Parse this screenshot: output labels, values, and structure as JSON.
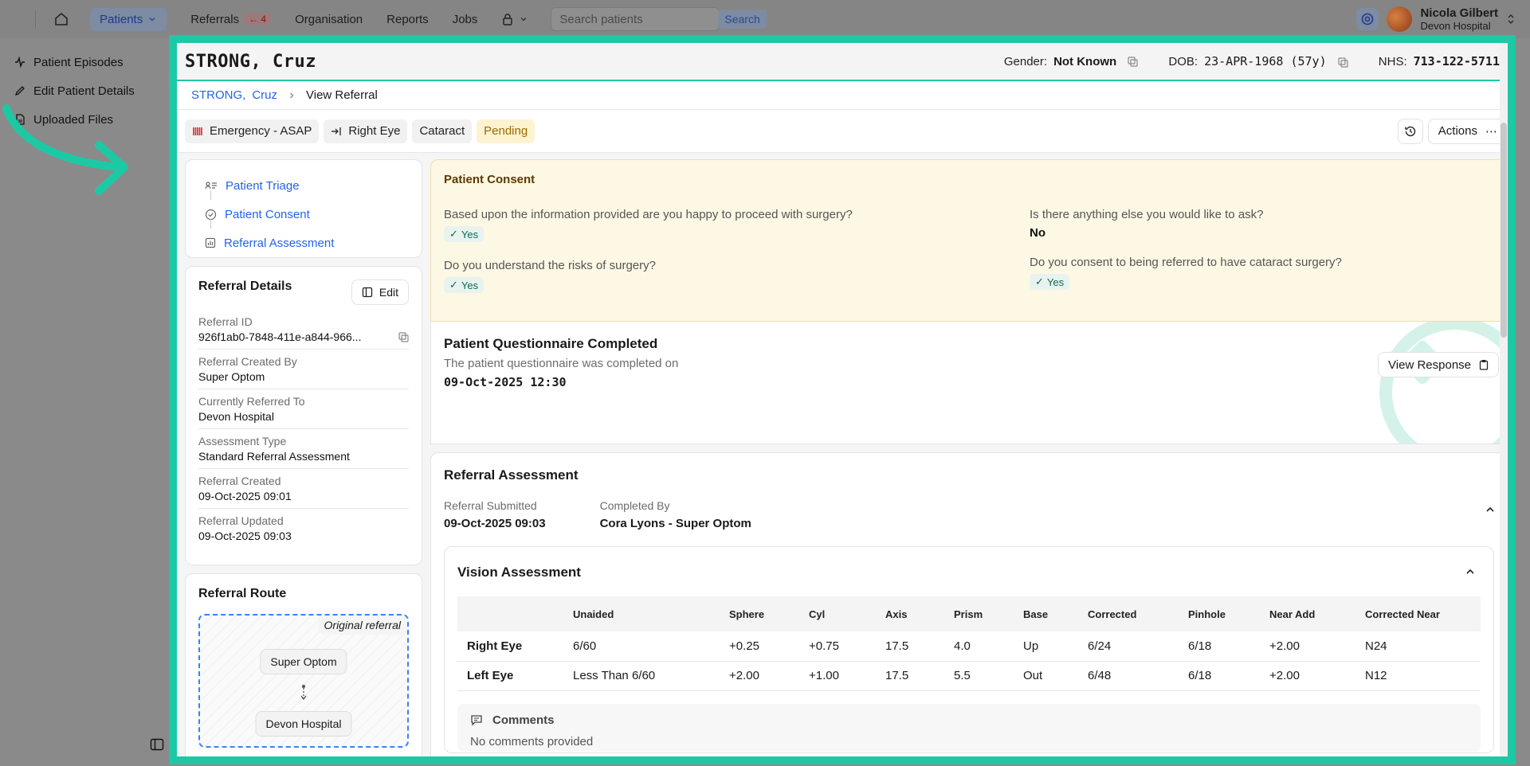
{
  "nav": {
    "items": [
      {
        "label": "Patients"
      },
      {
        "label": "Referrals",
        "badge": "4"
      },
      {
        "label": "Organisation"
      },
      {
        "label": "Reports"
      },
      {
        "label": "Jobs"
      }
    ],
    "search_placeholder": "Search patients",
    "search_button": "Search",
    "user_name": "Nicola Gilbert",
    "user_org": "Devon Hospital"
  },
  "sidebar": {
    "items": [
      {
        "label": "Patient Episodes",
        "icon": "activity-icon"
      },
      {
        "label": "Edit Patient Details",
        "icon": "pencil-icon"
      },
      {
        "label": "Uploaded Files",
        "icon": "file-icon"
      }
    ]
  },
  "patient": {
    "name": "STRONG, Cruz",
    "gender_label": "Gender:",
    "gender": "Not Known",
    "dob_label": "DOB:",
    "dob": "23-APR-1968 (57y)",
    "nhs_label": "NHS:",
    "nhs": "713-122-5711"
  },
  "breadcrumb": {
    "last": "STRONG,",
    "first": "Cruz",
    "current": "View Referral"
  },
  "tags": {
    "priority": "Emergency - ASAP",
    "eye": "Right Eye",
    "condition": "Cataract",
    "status": "Pending",
    "actions": "Actions"
  },
  "steps": [
    {
      "label": "Patient Triage"
    },
    {
      "label": "Patient Consent"
    },
    {
      "label": "Referral Assessment"
    }
  ],
  "details": {
    "title": "Referral Details",
    "edit": "Edit",
    "rows": [
      {
        "label": "Referral ID",
        "value": "926f1ab0-7848-411e-a844-966..."
      },
      {
        "label": "Referral Created By",
        "value": "Super Optom"
      },
      {
        "label": "Currently Referred To",
        "value": "Devon Hospital"
      },
      {
        "label": "Assessment Type",
        "value": "Standard Referral Assessment"
      },
      {
        "label": "Referral Created",
        "value": "09-Oct-2025 09:01"
      },
      {
        "label": "Referral Updated",
        "value": "09-Oct-2025 09:03"
      }
    ]
  },
  "route": {
    "title": "Referral Route",
    "tag": "Original referral",
    "from": "Super Optom",
    "to": "Devon Hospital"
  },
  "consent": {
    "title": "Patient Consent",
    "q1": "Based upon the information provided are you happy to proceed with surgery?",
    "a1": "Yes",
    "q2": "Do you understand the risks of surgery?",
    "a2": "Yes",
    "q3": "Is there anything else you would like to ask?",
    "a3": "No",
    "q4": "Do you consent to being referred to have cataract surgery?",
    "a4": "Yes"
  },
  "questionnaire": {
    "title": "Patient Questionnaire Completed",
    "sub": "The patient questionnaire was completed on",
    "date": "09-Oct-2025 12:30",
    "button": "View Response"
  },
  "assessment": {
    "title": "Referral Assessment",
    "submitted_label": "Referral Submitted",
    "submitted": "09-Oct-2025 09:03",
    "completed_label": "Completed By",
    "completed": "Cora Lyons - Super Optom"
  },
  "vision": {
    "title": "Vision Assessment",
    "columns": [
      "",
      "Unaided",
      "Sphere",
      "Cyl",
      "Axis",
      "Prism",
      "Base",
      "Corrected",
      "Pinhole",
      "Near Add",
      "Corrected Near"
    ],
    "rows": [
      [
        "Right Eye",
        "6/60",
        "+0.25",
        "+0.75",
        "17.5",
        "4.0",
        "Up",
        "6/24",
        "6/18",
        "+2.00",
        "N24"
      ],
      [
        "Left Eye",
        "Less Than 6/60",
        "+2.00",
        "+1.00",
        "17.5",
        "5.5",
        "Out",
        "6/48",
        "6/18",
        "+2.00",
        "N12"
      ]
    ],
    "comments_title": "Comments",
    "comments_value": "No comments provided"
  },
  "colors": {
    "highlight": "#1dc9a4",
    "link": "#2563eb",
    "pending": "#9a6a00"
  }
}
